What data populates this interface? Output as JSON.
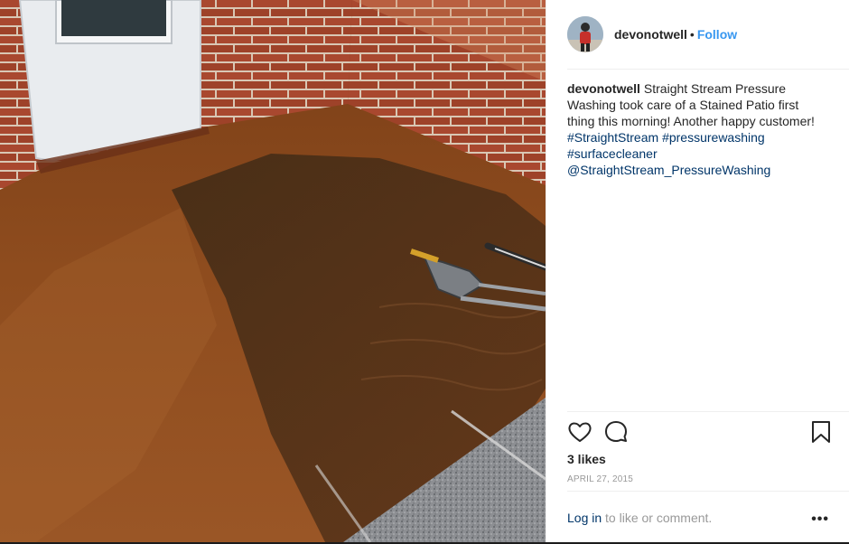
{
  "post": {
    "author": {
      "username": "devonotwell",
      "follow_label": "Follow",
      "separator": "•"
    },
    "caption": {
      "username": "devonotwell",
      "text": "Straight Stream Pressure Washing took care of a Stained Patio first thing this morning! Another happy customer!",
      "tags": [
        "#StraightStream",
        "#pressurewashing",
        "#surfacecleaner",
        "@StraightStream_PressureWashing"
      ]
    },
    "likes": "3 likes",
    "date": "APRIL 27, 2015",
    "login": {
      "link_label": "Log in",
      "rest": " to like or comment."
    },
    "more_label": "•••",
    "colors": {
      "link": "#003569",
      "follow": "#3897f0",
      "brick": "#a9482f",
      "patio": "#8a4a1f"
    },
    "icons": [
      "heart-icon",
      "comment-icon",
      "bookmark-icon",
      "more-options-icon"
    ]
  }
}
